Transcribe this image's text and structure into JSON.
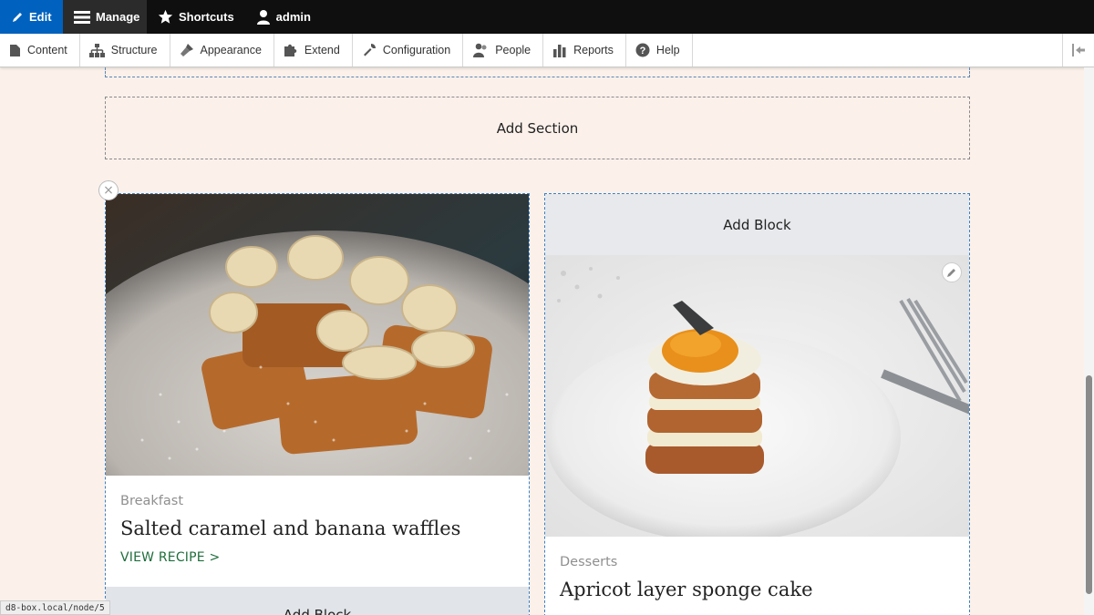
{
  "toolbar": {
    "edit": "Edit",
    "manage": "Manage",
    "shortcuts": "Shortcuts",
    "user": "admin"
  },
  "tray": {
    "items": [
      {
        "label": "Content",
        "icon": "page-icon"
      },
      {
        "label": "Structure",
        "icon": "sitemap-icon"
      },
      {
        "label": "Appearance",
        "icon": "paintbrush-icon"
      },
      {
        "label": "Extend",
        "icon": "puzzle-icon"
      },
      {
        "label": "Configuration",
        "icon": "wrench-icon"
      },
      {
        "label": "People",
        "icon": "people-icon"
      },
      {
        "label": "Reports",
        "icon": "bar-chart-icon"
      },
      {
        "label": "Help",
        "icon": "question-icon"
      }
    ]
  },
  "layout": {
    "add_section": "Add Section",
    "add_block": "Add Block",
    "remove_symbol": "×"
  },
  "cards": [
    {
      "category": "Breakfast",
      "title": "Salted caramel and banana waffles",
      "link": "VIEW RECIPE >"
    },
    {
      "category": "Desserts",
      "title": "Apricot layer sponge cake"
    }
  ],
  "status": {
    "url": "d8-box.local/node/5"
  },
  "colors": {
    "edit_blue": "#0062be",
    "toolbar_black": "#0f0f0f",
    "page_bg": "#fbf1ea",
    "region_border": "#3f7fc0",
    "link_green": "#1f6e3c"
  }
}
